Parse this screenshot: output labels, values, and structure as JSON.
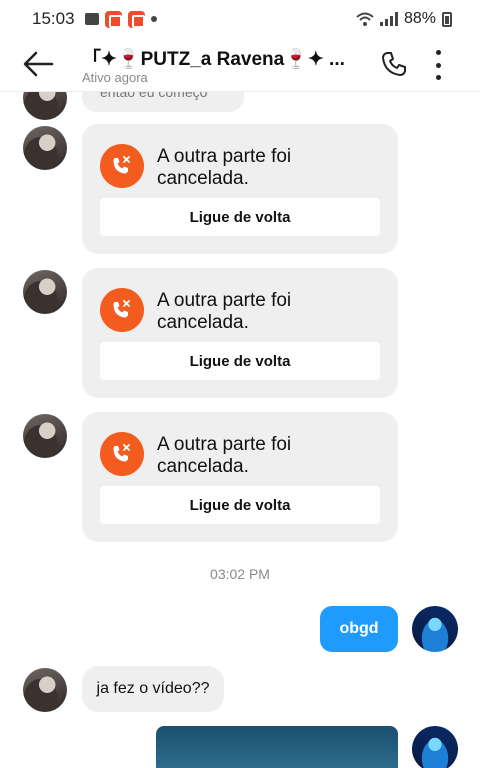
{
  "status_bar": {
    "time": "15:03",
    "battery": "88%"
  },
  "header": {
    "title": "「✦🍷PUTZ_a Ravena🍷✦ ...",
    "subtitle": "Ativo agora"
  },
  "chat": {
    "partial_message": "então eu começo",
    "calls": [
      {
        "text": "A outra parte foi cancelada.",
        "button": "Ligue de volta"
      },
      {
        "text": "A outra parte foi cancelada.",
        "button": "Ligue de volta"
      },
      {
        "text": "A outra parte foi cancelada.",
        "button": "Ligue de volta"
      }
    ],
    "timestamp": "03:02 PM",
    "outgoing_message": "obgd",
    "incoming_message": "ja fez o vídeo??"
  },
  "colors": {
    "accent_blue": "#1e9bfd",
    "call_icon_orange": "#f25c1f",
    "bubble_gray": "#efefef"
  },
  "icons": [
    "back-arrow-icon",
    "phone-icon",
    "more-vertical-icon",
    "missed-call-icon"
  ]
}
